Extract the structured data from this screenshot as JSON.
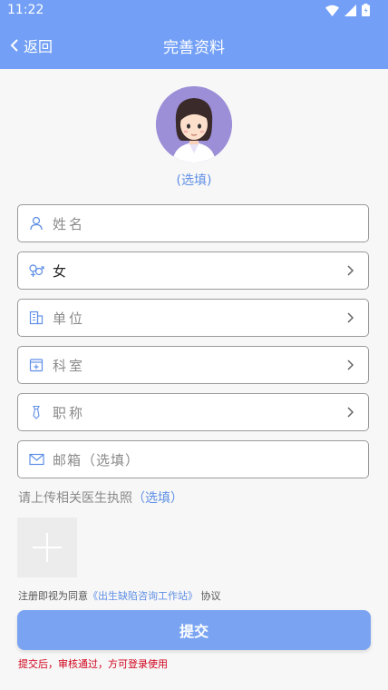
{
  "statusbar": {
    "time": "11:22"
  },
  "nav": {
    "back_label": "返回",
    "title": "完善资料"
  },
  "avatar": {
    "hint": "(选填)"
  },
  "fields": {
    "name": {
      "placeholder": "姓名",
      "icon": "person-icon"
    },
    "gender": {
      "value": "女",
      "icon": "gender-icon"
    },
    "company": {
      "placeholder": "单位",
      "icon": "building-icon"
    },
    "department": {
      "placeholder": "科室",
      "icon": "medical-box-icon"
    },
    "title": {
      "placeholder": "职称",
      "icon": "tie-icon"
    },
    "email": {
      "placeholder": "邮箱（选填）",
      "icon": "mail-icon"
    }
  },
  "upload": {
    "title": "请上传相关医生执照",
    "optional": "（选填）"
  },
  "agreement": {
    "prefix": "注册即视为同意",
    "link": "《出生缺陷咨询工作站》",
    "suffix": "协议"
  },
  "submit": {
    "label": "提交"
  },
  "note": "提交后，审核通过，方可登录使用",
  "colors": {
    "header": "#73a0f6",
    "accent": "#5f8fe6",
    "warning": "#d0021b"
  }
}
